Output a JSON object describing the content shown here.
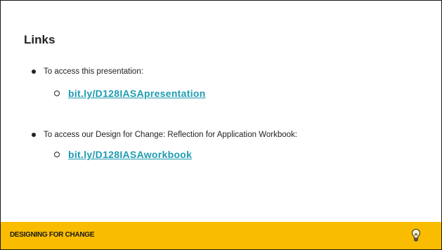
{
  "slide": {
    "title": "Links",
    "bullets": [
      {
        "text": "To access this presentation:",
        "link": "bit.ly/D128IASApresentation"
      },
      {
        "text": "To access our Design for Change: Reflection for Application Workbook:",
        "link": "bit.ly/D128IASAworkbook"
      }
    ],
    "footer": {
      "label": "DESIGNING FOR CHANGE",
      "icon": "lightbulb-icon"
    },
    "colors": {
      "footer_bg": "#f9bc00",
      "link": "#1e9bb0",
      "text": "#222222"
    }
  }
}
